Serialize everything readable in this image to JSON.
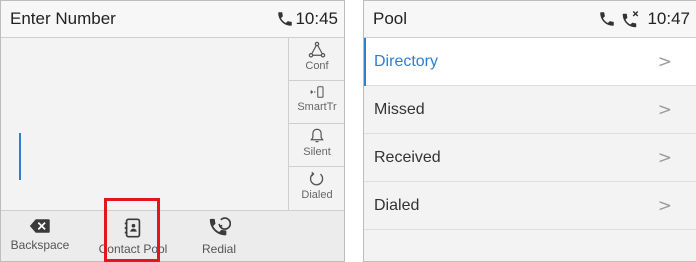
{
  "left_screen": {
    "title": "Enter Number",
    "time": "10:45",
    "softkeys": [
      {
        "label": "Conf",
        "icon": "conference-icon"
      },
      {
        "label": "SmartTr",
        "icon": "smart-transfer-icon"
      },
      {
        "label": "Silent",
        "icon": "bell-icon"
      },
      {
        "label": "Dialed",
        "icon": "dialed-icon"
      }
    ],
    "bottom_keys": [
      {
        "label": "Backspace",
        "icon": "backspace-icon"
      },
      {
        "label": "Contact Pool",
        "icon": "contact-book-icon"
      },
      {
        "label": "Redial",
        "icon": "redial-icon"
      }
    ]
  },
  "right_screen": {
    "title": "Pool",
    "time": "10:47",
    "menu": [
      {
        "label": "Directory",
        "selected": true
      },
      {
        "label": "Missed",
        "selected": false
      },
      {
        "label": "Received",
        "selected": false
      },
      {
        "label": "Dialed",
        "selected": false
      }
    ],
    "chevron": ">"
  },
  "colors": {
    "accent": "#2f7fd0",
    "highlight": "#e3161d"
  }
}
